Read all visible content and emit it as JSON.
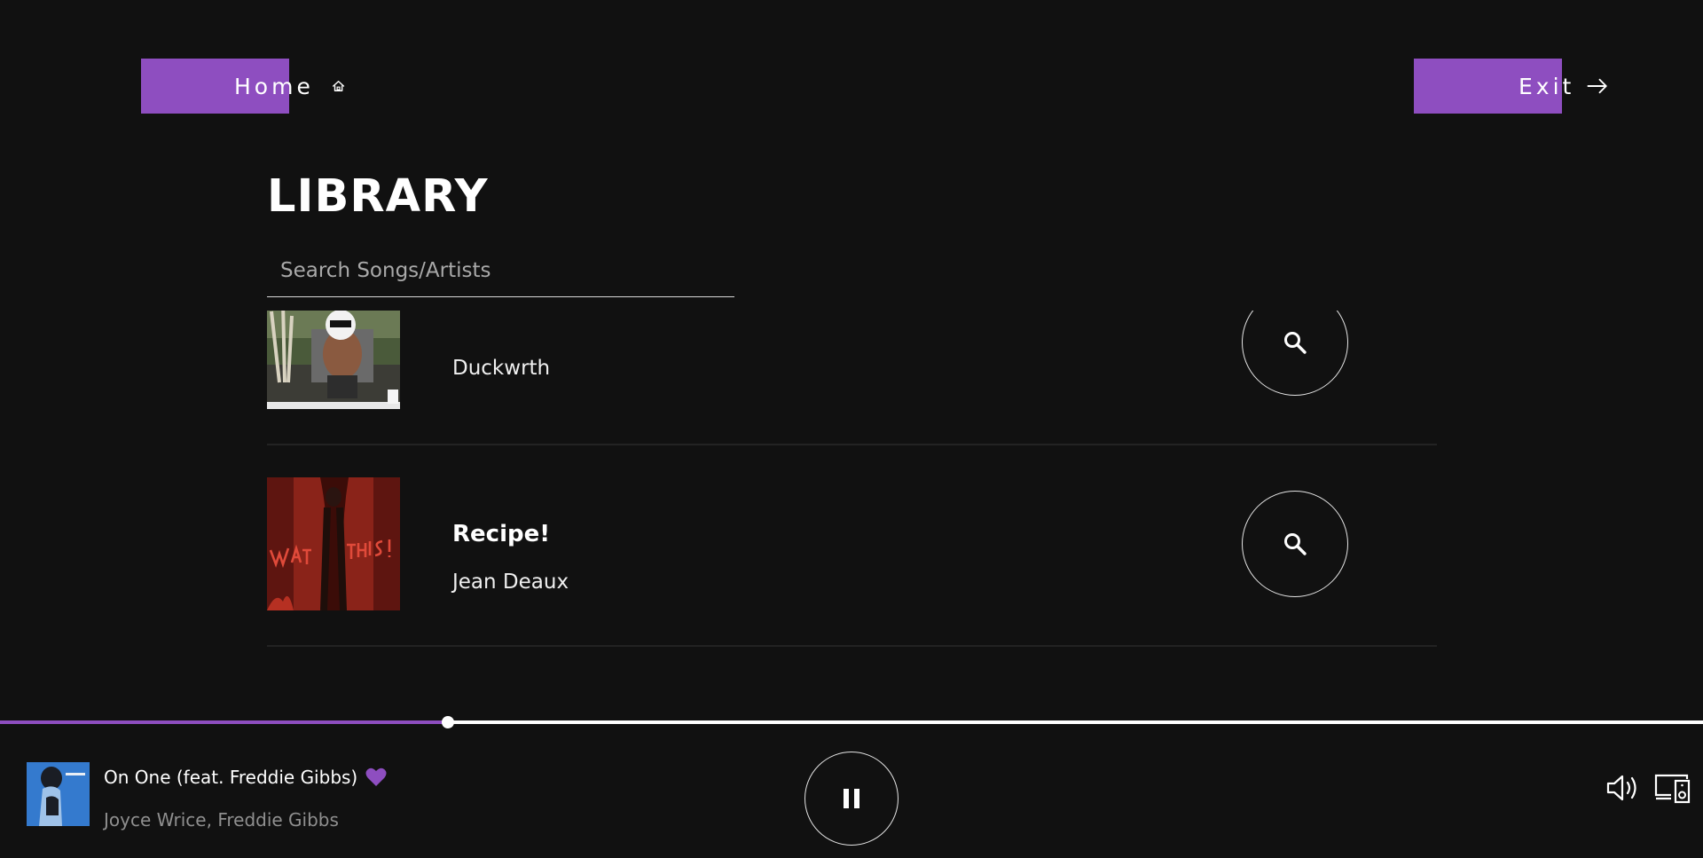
{
  "header": {
    "home_label": "Home",
    "exit_label": "Exit"
  },
  "library": {
    "title": "LIBRARY",
    "search_placeholder": "Search Songs/Artists",
    "search_value": ""
  },
  "tracks": [
    {
      "title": "",
      "artist": "Duckwrth"
    },
    {
      "title": "Recipe!",
      "artist": "Jean Deaux"
    }
  ],
  "player": {
    "title": "On One (feat. Freddie Gibbs)",
    "artists": [
      "Joyce Wrice",
      "Freddie Gibbs"
    ],
    "artist_separator": ", ",
    "progress_fraction": 0.263,
    "liked": true,
    "state": "playing"
  },
  "colors": {
    "accent": "#8e4ec0",
    "background": "#111111",
    "text": "#ffffff",
    "muted": "#8f8f8f"
  },
  "icons": [
    "home-icon",
    "arrow-right-icon",
    "search-icon",
    "heart-icon",
    "pause-icon",
    "volume-icon",
    "device-icon"
  ]
}
